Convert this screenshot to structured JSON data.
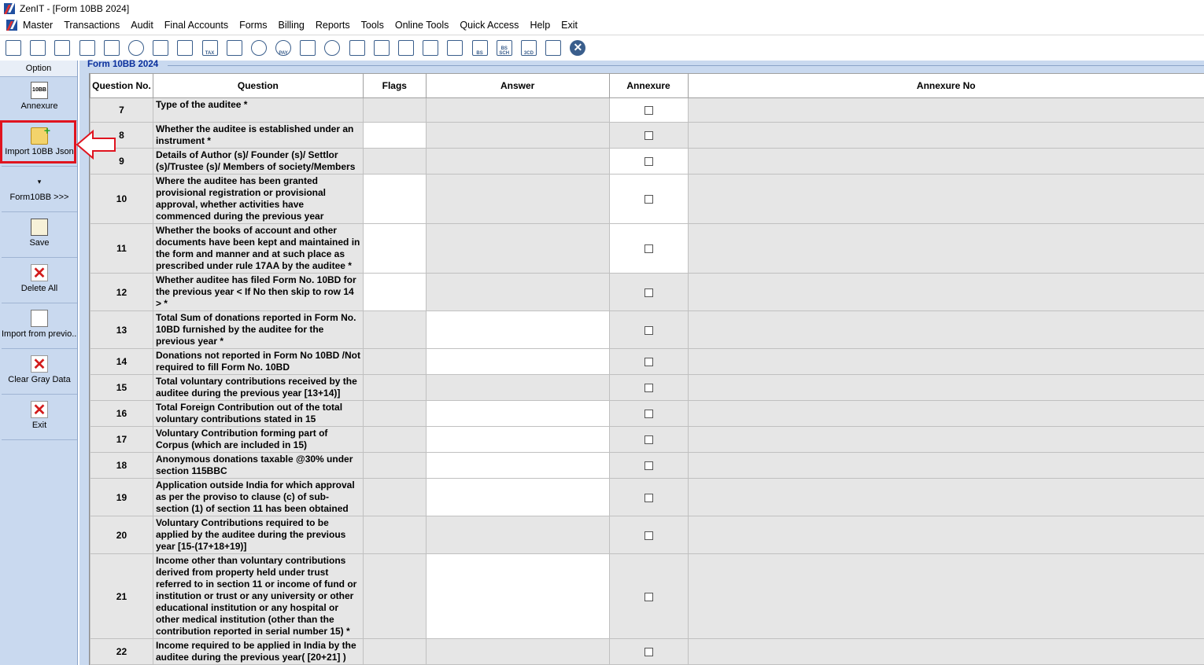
{
  "window": {
    "title": "ZenIT - [Form 10BB 2024]"
  },
  "menu": [
    "Master",
    "Transactions",
    "Audit",
    "Final Accounts",
    "Forms",
    "Billing",
    "Reports",
    "Tools",
    "Online Tools",
    "Quick Access",
    "Help",
    "Exit"
  ],
  "toolbar_icons": [
    "ledger-icon",
    "home-icon",
    "building-icon",
    "bar-chart-icon",
    "gift-icon",
    "people-icon",
    "tag-icon",
    "filter-icon",
    "tax-icon",
    "calculator-icon",
    "pie-chart-icon",
    "pay-icon",
    "book-icon",
    "info-icon",
    "report-icon",
    "user-doc-icon",
    "calendar-icon",
    "folder-add-icon",
    "refresh-doc-icon",
    "bs-icon",
    "bs-sch-icon",
    "3cd-icon",
    "form-icon",
    "close-circle-icon"
  ],
  "toolbar_icon_texts": {
    "tax": "TAX",
    "pay": "PAY",
    "bs": "BS",
    "bssch": "BS SCH",
    "cd": "3CD"
  },
  "sidebar": {
    "header": "Option",
    "buttons": [
      {
        "label": "Annexure",
        "icon": "10BB"
      },
      {
        "label": "Import 10BB Json"
      },
      {
        "label": "Form10BB >>>"
      },
      {
        "label": "Save"
      },
      {
        "label": "Delete All"
      },
      {
        "label": "Import from previo..."
      },
      {
        "label": "Clear Gray Data"
      },
      {
        "label": "Exit"
      }
    ]
  },
  "form": {
    "title": "Form 10BB 2024",
    "columns": [
      "Question No.",
      "Question",
      "Flags",
      "Answer",
      "Annexure",
      "Annexure No"
    ],
    "rows": [
      {
        "no": "7",
        "q": "Type of the auditee *"
      },
      {
        "no": "8",
        "q": "Whether the auditee is established under an instrument *"
      },
      {
        "no": "9",
        "q": "Details of Author (s)/ Founder (s)/ Settlor (s)/Trustee (s)/ Members of society/Members"
      },
      {
        "no": "10",
        "q": "Where the auditee has been granted provisional registration or provisional approval, whether activities have commenced during the previous year"
      },
      {
        "no": "11",
        "q": "Whether the books of account and other documents have been kept and maintained in the form and manner and at such place as prescribed under rule 17AA by the auditee *"
      },
      {
        "no": "12",
        "q": "Whether auditee has filed Form No. 10BD for the previous year  < If No then skip to row 14 > *"
      },
      {
        "no": "13",
        "q": "Total Sum of donations reported in Form No. 10BD furnished by the auditee for the previous year *"
      },
      {
        "no": "14",
        "q": "Donations not reported in Form No 10BD /Not required to fill Form No. 10BD"
      },
      {
        "no": "15",
        "q": "Total voluntary contributions received by the auditee during the previous year [13+14)]"
      },
      {
        "no": "16",
        "q": "Total Foreign Contribution out of the total voluntary contributions stated in 15"
      },
      {
        "no": "17",
        "q": "Voluntary Contribution forming part of Corpus (which are included in 15)"
      },
      {
        "no": "18",
        "q": "Anonymous donations taxable @30% under section 115BBC"
      },
      {
        "no": "19",
        "q": "Application outside India for which approval as per the proviso to clause (c) of sub-section (1) of section 11 has been obtained"
      },
      {
        "no": "20",
        "q": "Voluntary Contributions required to be applied by the auditee during the previous year [15-(17+18+19)]"
      },
      {
        "no": "21",
        "q": "Income other than voluntary contributions derived from property held under trust referred to in section 11 or income of fund or institution or trust or any university or other educational institution or any hospital or other medical institution (other than the contribution reported in serial number 15) *"
      },
      {
        "no": "22",
        "q": "Income required to be applied in India by the auditee during the previous year( [20+21] )"
      }
    ]
  }
}
